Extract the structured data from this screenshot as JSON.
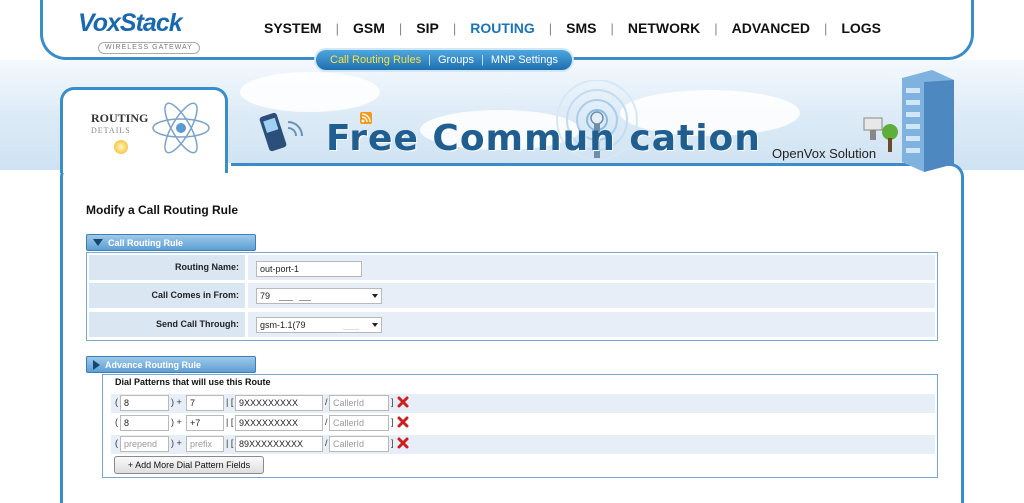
{
  "brand": {
    "name": "VoxStack",
    "tagline": "WIRELESS GATEWAY"
  },
  "main_nav": [
    {
      "label": "SYSTEM",
      "active": false
    },
    {
      "label": "GSM",
      "active": false
    },
    {
      "label": "SIP",
      "active": false
    },
    {
      "label": "ROUTING",
      "active": true
    },
    {
      "label": "SMS",
      "active": false
    },
    {
      "label": "NETWORK",
      "active": false
    },
    {
      "label": "ADVANCED",
      "active": false
    },
    {
      "label": "LOGS",
      "active": false
    }
  ],
  "sub_nav": [
    {
      "label": "Call Routing Rules",
      "active": true
    },
    {
      "label": "Groups",
      "active": false
    },
    {
      "label": "MNP Settings",
      "active": false
    }
  ],
  "details_tab": {
    "title": "ROUTING",
    "subtitle": "DETAILS"
  },
  "banner": {
    "title": "Free Commun  cation",
    "brand": "OpenVox Solution"
  },
  "page_title": "Modify a Call Routing Rule",
  "rule_section": {
    "header": "Call Routing Rule",
    "routing_name_label": "Routing Name:",
    "routing_name_value": "out-port-1",
    "call_comes_label": "Call Comes in From:",
    "call_comes_value": "79",
    "send_through_label": "Send Call Through:",
    "send_through_value": "gsm-1.1(79"
  },
  "advance_section": {
    "header": "Advance Routing Rule",
    "caption": "Dial Patterns that will use this Route",
    "patterns": [
      {
        "prepend": "8",
        "prefix": "7",
        "pattern": "9XXXXXXXXX",
        "callerid": ""
      },
      {
        "prepend": "8",
        "prefix": "+7",
        "pattern": "9XXXXXXXXX",
        "callerid": ""
      },
      {
        "prepend": "",
        "prefix": "",
        "pattern": "89XXXXXXXXX",
        "callerid": ""
      }
    ],
    "placeholders": {
      "prepend": "prepend",
      "prefix": "prefix",
      "callerid": "CallerId"
    },
    "add_button": "+ Add More Dial Pattern Fields"
  },
  "icons": [
    "atom-icon",
    "phone-icon",
    "rss-icon",
    "antenna-icon",
    "building-icon",
    "delete-icon",
    "dropdown-caret-icon"
  ],
  "colors": {
    "frame_blue": "#3a8dc9",
    "nav_active": "#1e73b6",
    "subnav_active": "#ffe23c",
    "row_bg": "#e7eef8",
    "label_bg": "#dbe6f3",
    "delete_red": "#cc1f1f"
  }
}
